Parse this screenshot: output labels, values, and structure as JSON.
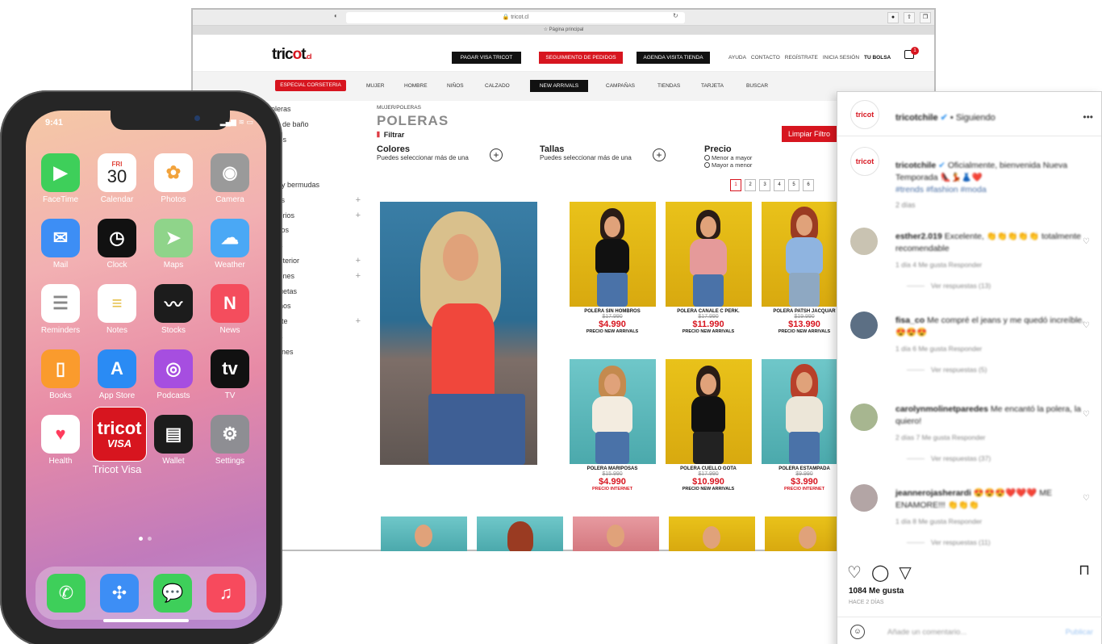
{
  "browser": {
    "url": "🔒 tricot.cl",
    "favorites": "☆ Página principal"
  },
  "site": {
    "logo_main": "tric",
    "logo_o": "o",
    "logo_t": "t",
    "logo_tld": ".cl",
    "header_buttons": [
      "PAGAR VISA TRICOT",
      "SEGUIMIENTO DE PEDIDOS",
      "AGENDA VISITA TIENDA"
    ],
    "header_links": [
      "AYUDA",
      "CONTACTO",
      "REGÍSTRATE",
      "INICIA SESIÓN"
    ],
    "bag_label": "TU BOLSA",
    "bag_count": "1",
    "nav": [
      "ESPECIAL CORSETERIA",
      "MUJER",
      "HOMBRE",
      "NIÑOS",
      "CALZADO",
      "NEW ARRIVALS",
      "CAMPAÑAS",
      "TIENDAS",
      "TARJETA",
      "BUSCAR"
    ],
    "sidebar": [
      "oleras",
      "jes de baño",
      "tidos",
      "sas",
      "ns",
      "ort y bermudas",
      "mas",
      "esorios",
      "eritos",
      "das",
      "a interior",
      "talones",
      "aquetas",
      "nonos",
      "porte",
      "dos",
      "erones"
    ],
    "breadcrumb": "MUJER/POLERAS",
    "page_title": "POLERAS",
    "filter_label": "Filtrar",
    "filters": {
      "colors_title": "Colores",
      "colors_sub": "Puedes seleccionar más de una",
      "sizes_title": "Tallas",
      "sizes_sub": "Puedes seleccionar más de una",
      "price_title": "Precio",
      "price_opt1": "Menor a mayor",
      "price_opt2": "Mayor a menor"
    },
    "clear_filters": "Limpiar Filtro",
    "pages": [
      "1",
      "2",
      "3",
      "4",
      "5",
      "6"
    ],
    "products": [
      {
        "name": "POLERA SIN HOMBROS",
        "old": "$17.990",
        "price": "$4.990",
        "badge": "PRECIO NEW ARRIVALS"
      },
      {
        "name": "POLERA CANALE C PERK.",
        "old": "$17.990",
        "price": "$11.990",
        "badge": "PRECIO NEW ARRIVALS"
      },
      {
        "name": "POLERA PATSH JACQUAR",
        "old": "$19.990",
        "price": "$13.990",
        "badge": "PRECIO NEW ARRIVALS"
      },
      {
        "name": "POLERA MARIPOSAS",
        "old": "$15.990",
        "price": "$4.990",
        "badge": "PRECIO INTERNET"
      },
      {
        "name": "POLERA CUELLO GOTA",
        "old": "$17.990",
        "price": "$10.990",
        "badge": "PRECIO NEW ARRIVALS"
      },
      {
        "name": "POLERA ESTAMPADA",
        "old": "$9.990",
        "price": "$3.990",
        "badge": "PRECIO INTERNET"
      }
    ]
  },
  "phone": {
    "time": "9:41",
    "status_icons": "▂▄▆ ≋ ▭",
    "apps": [
      {
        "label": "FaceTime",
        "icon": "facetime-icon",
        "glyph": "▶",
        "color": "#3ecf5a"
      },
      {
        "label": "Calendar",
        "icon": "calendar-icon",
        "glyph": "30",
        "color": "#ffffff"
      },
      {
        "label": "Photos",
        "icon": "photos-icon",
        "glyph": "✿",
        "color": "#ffffff"
      },
      {
        "label": "Camera",
        "icon": "camera-icon",
        "glyph": "◉",
        "color": "#9a9a9a"
      },
      {
        "label": "Mail",
        "icon": "mail-icon",
        "glyph": "✉",
        "color": "#3d8ef5"
      },
      {
        "label": "Clock",
        "icon": "clock-icon",
        "glyph": "◷",
        "color": "#111111"
      },
      {
        "label": "Maps",
        "icon": "maps-icon",
        "glyph": "➤",
        "color": "#8fd48a"
      },
      {
        "label": "Weather",
        "icon": "weather-icon",
        "glyph": "☁",
        "color": "#4aa8f5"
      },
      {
        "label": "Reminders",
        "icon": "reminders-icon",
        "glyph": "☰",
        "color": "#ffffff"
      },
      {
        "label": "Notes",
        "icon": "notes-icon",
        "glyph": "≡",
        "color": "#ffffff"
      },
      {
        "label": "Stocks",
        "icon": "stocks-icon",
        "glyph": "〰",
        "color": "#1c1c1c"
      },
      {
        "label": "News",
        "icon": "news-icon",
        "glyph": "N",
        "color": "#f44d5d"
      },
      {
        "label": "Books",
        "icon": "books-icon",
        "glyph": "▯",
        "color": "#fa9b2d"
      },
      {
        "label": "App Store",
        "icon": "app-store-icon",
        "glyph": "A",
        "color": "#2a8bf4"
      },
      {
        "label": "Podcasts",
        "icon": "podcasts-icon",
        "glyph": "◎",
        "color": "#a64ee0"
      },
      {
        "label": "TV",
        "icon": "tv-icon",
        "glyph": "tv",
        "color": "#111111"
      },
      {
        "label": "Health",
        "icon": "health-icon",
        "glyph": "♥",
        "color": "#ffffff"
      },
      {
        "label": "Tricot Visa",
        "icon": "tricot-visa-icon",
        "glyph": "tricot",
        "color": "#d7151f"
      },
      {
        "label": "Wallet",
        "icon": "wallet-icon",
        "glyph": "▤",
        "color": "#1c1c1c"
      },
      {
        "label": "Settings",
        "icon": "settings-icon",
        "glyph": "⚙",
        "color": "#8e8e93"
      }
    ],
    "calendar_day": "FRI",
    "tricot_app_text": "tricot",
    "tricot_app_visa": "VISA",
    "dock": [
      {
        "icon": "phone-icon",
        "glyph": "✆",
        "color": "#3ecf5a"
      },
      {
        "icon": "safari-icon",
        "glyph": "✣",
        "color": "#3d8ef5"
      },
      {
        "icon": "messages-icon",
        "glyph": "💬",
        "color": "#3ecf5a"
      },
      {
        "icon": "music-icon",
        "glyph": "♫",
        "color": "#f74a5d"
      }
    ]
  },
  "instagram": {
    "avatar_text": "tricot",
    "username": "tricotchile",
    "verified": "✔",
    "follow_state": "• Siguiendo",
    "more": "•••",
    "caption_user": "tricotchile",
    "caption_text": "Oficialmente, bienvenida Nueva Temporada 👠💃👗❤️",
    "caption_tags": "#trends #fashion #moda",
    "caption_time": "2 días",
    "comments": [
      {
        "user": "esther2.019",
        "text": "Excelente, 👏👏👏👏👏 totalmente recomendable",
        "meta": "1 día   4 Me gusta   Responder",
        "replies": "Ver respuestas (13)"
      },
      {
        "user": "fisa_co",
        "text": "Me compré el jeans y me quedó increíble. 😍😍😍",
        "meta": "1 día   6 Me gusta   Responder",
        "replies": "Ver respuestas (5)"
      },
      {
        "user": "carolynmolinetparedes",
        "text": "Me encantó la polera, la quiero!",
        "meta": "2 días   7 Me gusta   Responder",
        "replies": "Ver respuestas (37)"
      },
      {
        "user": "jeannerojasherardi",
        "text": "😍😍😍❤️❤️❤️ ME ENAMORE!!! 👏👏👏",
        "meta": "1 día   8 Me gusta   Responder",
        "replies": "Ver respuestas (11)"
      }
    ],
    "likes": "1084 Me gusta",
    "date": "HACE 2 DÍAS",
    "comment_placeholder": "Añade un comentario...",
    "publish": "Publicar"
  }
}
